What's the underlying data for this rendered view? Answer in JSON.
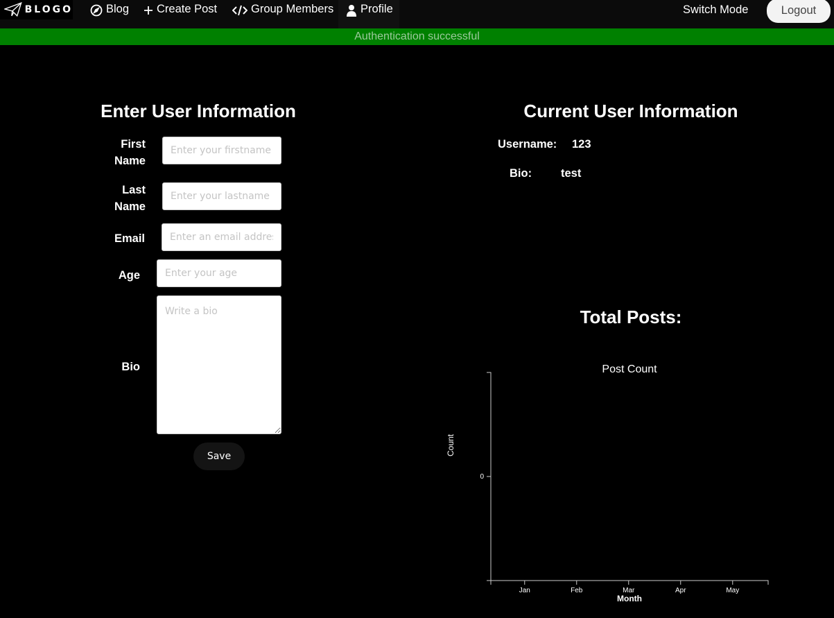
{
  "nav": {
    "logo_text": "BLOGO",
    "blog": "Blog",
    "create_post": "Create Post",
    "group_members": "Group Members",
    "profile": "Profile",
    "switch_mode": "Switch Mode",
    "logout": "Logout"
  },
  "banner": {
    "message": "Authentication successful",
    "color": "#008000"
  },
  "form": {
    "title": "Enter User Information",
    "first_name_label_1": "First",
    "first_name_label_2": "Name",
    "first_name_placeholder": "Enter your firstname",
    "last_name_label_1": "Last",
    "last_name_label_2": "Name",
    "last_name_placeholder": "Enter your lastname",
    "email_label": "Email",
    "email_placeholder": "Enter an email address",
    "age_label": "Age",
    "age_placeholder": "Enter your age",
    "bio_label": "Bio",
    "bio_placeholder": "Write a bio",
    "save_label": "Save"
  },
  "current": {
    "title": "Current User Information",
    "username_label": "Username:",
    "username_value": "123",
    "bio_label": "Bio:",
    "bio_value": "test"
  },
  "posts": {
    "title": "Total Posts:"
  },
  "chart_data": {
    "type": "line",
    "title": "Post Count",
    "xlabel": "Month",
    "ylabel": "Count",
    "categories": [
      "Jan",
      "Feb",
      "Mar",
      "Apr",
      "May"
    ],
    "y_ticks": [
      "0"
    ],
    "series": []
  }
}
